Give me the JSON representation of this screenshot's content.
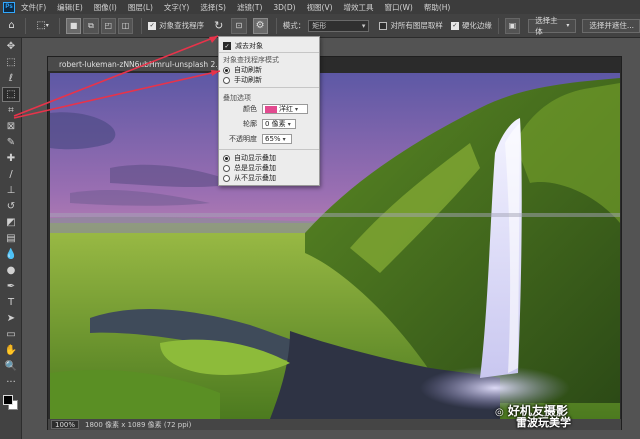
{
  "app": {
    "logo": "Ps"
  },
  "menu": [
    "文件(F)",
    "编辑(E)",
    "图像(I)",
    "图层(L)",
    "文字(Y)",
    "选择(S)",
    "滤镜(T)",
    "3D(D)",
    "视图(V)",
    "增效工具",
    "窗口(W)",
    "帮助(H)"
  ],
  "options": {
    "object_finder_label": "对象查找程序",
    "mode_label": "模式：",
    "mode_value": "矩形",
    "sample_all_layers_label": "对所有图层取样",
    "hard_edge_label": "硬化边缘",
    "select_subject_label": "选择主体",
    "select_mask_label": "选择并遮住..."
  },
  "document": {
    "tab_title": "robert-lukeman-zNN6ubHmruI-unsplash 2.jpg",
    "zoom": "100%",
    "status": "1800 像素 x 1089 像素 (72 ppi)"
  },
  "popup": {
    "subtract_label": "减去对象",
    "finder_mode_header": "对象查找程序模式",
    "auto_refresh": "自动刷新",
    "manual_refresh": "手动刷新",
    "overlay_header": "叠加选项",
    "color_label": "颜色",
    "color_value": "洋红",
    "outline_label": "轮廓",
    "outline_value": "0 像素",
    "opacity_label": "不透明度",
    "opacity_value": "65%",
    "auto_show": "自动显示叠加",
    "always_show": "总是显示叠加",
    "never_show": "从不显示叠加",
    "overlay_color": "#e24a8f"
  },
  "watermark": {
    "line1": "好机友摄影",
    "line2": "雷波玩美学"
  },
  "colors": {
    "arrow": "#e8334a",
    "accent": "#31a8ff"
  }
}
